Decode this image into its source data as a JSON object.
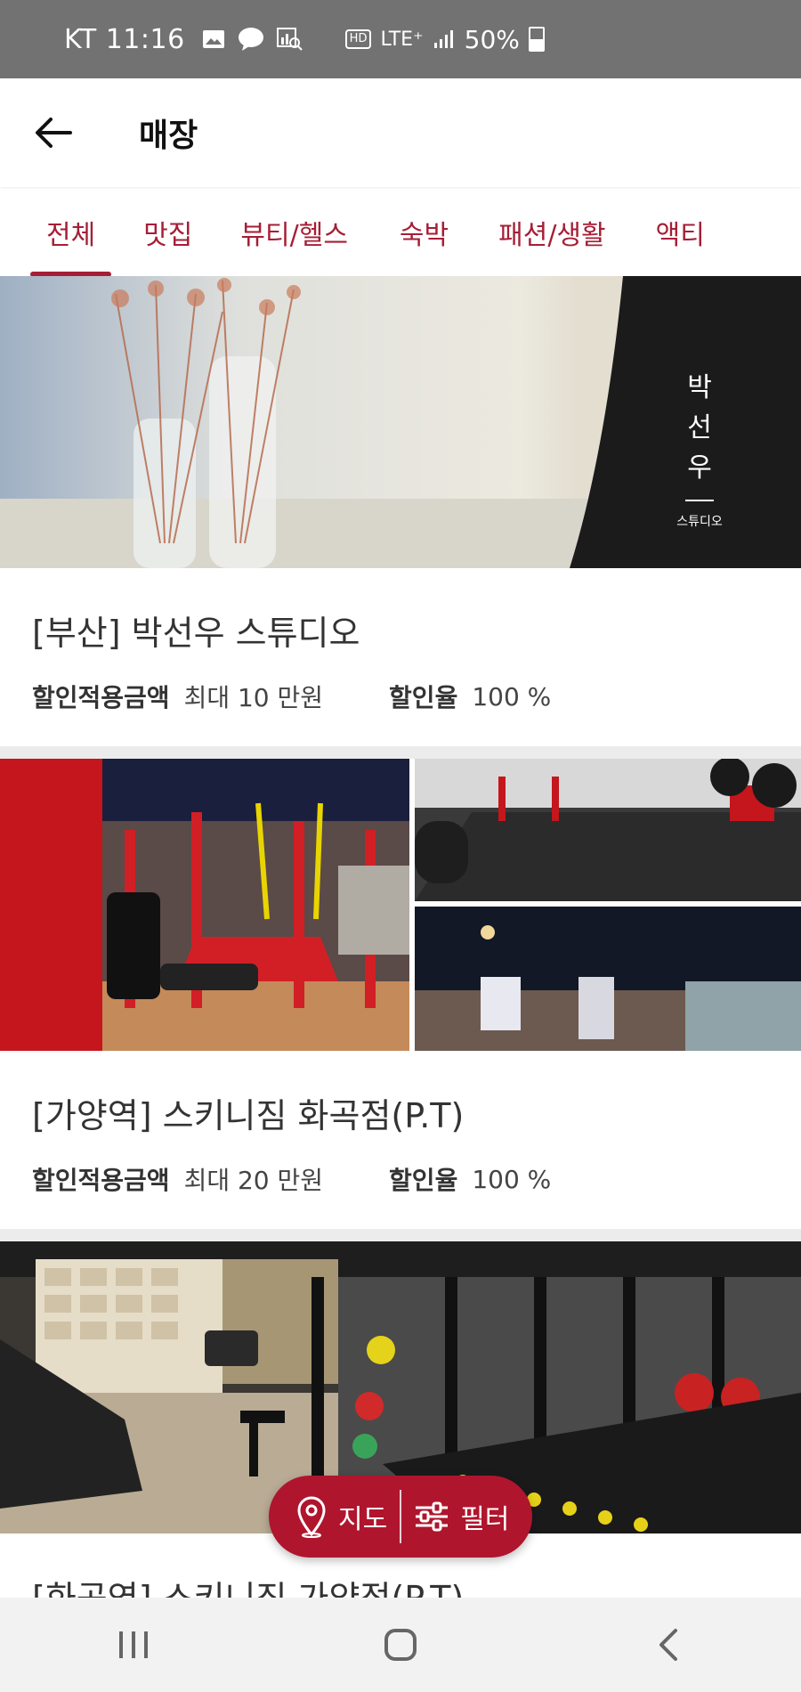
{
  "status_bar": {
    "carrier_time": "KT 11:16",
    "hd_badge": "HD",
    "network": "LTE⁺",
    "battery": "50%"
  },
  "header": {
    "title": "매장"
  },
  "tabs": [
    {
      "label": "전체",
      "active": true
    },
    {
      "label": "맛집",
      "active": false
    },
    {
      "label": "뷰티/헬스",
      "active": false
    },
    {
      "label": "숙박",
      "active": false
    },
    {
      "label": "패션/생활",
      "active": false
    },
    {
      "label": "액티",
      "active": false
    }
  ],
  "stores": [
    {
      "title": "[부산] 박선우 스튜디오",
      "discount_amount_label": "할인적용금액",
      "discount_amount_value": "최대 10 만원",
      "discount_rate_label": "할인율",
      "discount_rate_value": "100 %",
      "image_text_vertical": [
        "박",
        "선",
        "우"
      ],
      "image_text_small": "스튜디오"
    },
    {
      "title": "[가양역] 스키니짐 화곡점(P.T)",
      "discount_amount_label": "할인적용금액",
      "discount_amount_value": "최대 20 만원",
      "discount_rate_label": "할인율",
      "discount_rate_value": "100 %"
    },
    {
      "title": "[화곡역] 스키니짐 가양점(P.T)"
    }
  ],
  "fab": {
    "map_label": "지도",
    "filter_label": "필터"
  },
  "colors": {
    "accent": "#a61e36",
    "fab": "#b0152e",
    "status_bar": "#727272"
  }
}
